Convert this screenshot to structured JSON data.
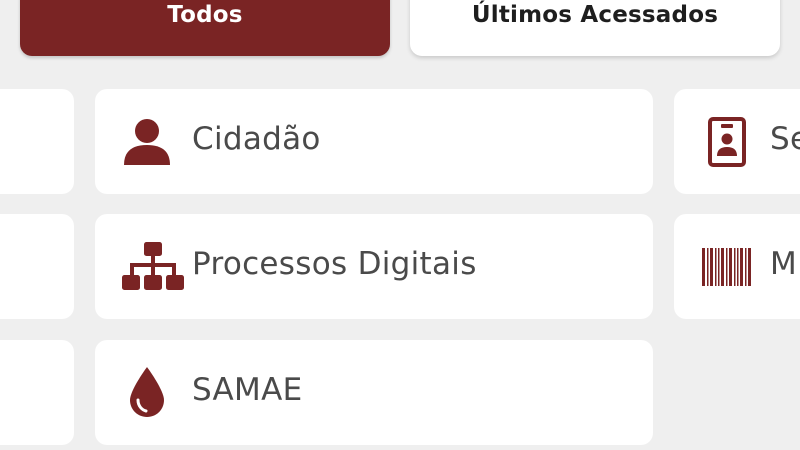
{
  "tabs": [
    {
      "label": "Todos",
      "active": true
    },
    {
      "label": "Últimos Acessados",
      "active": false
    }
  ],
  "grid": {
    "middle": [
      {
        "label": "Cidadão",
        "icon": "person-icon"
      },
      {
        "label": "Processos Digitais",
        "icon": "org-chart-icon"
      },
      {
        "label": "SAMAE",
        "icon": "water-drop-icon"
      }
    ],
    "right": [
      {
        "label": "Se",
        "icon": "id-badge-icon"
      },
      {
        "label": "M",
        "icon": "barcode-icon"
      }
    ]
  },
  "colors": {
    "accent": "#7a2424",
    "background": "#efefef",
    "card": "#ffffff",
    "text": "#4a4a4a"
  }
}
